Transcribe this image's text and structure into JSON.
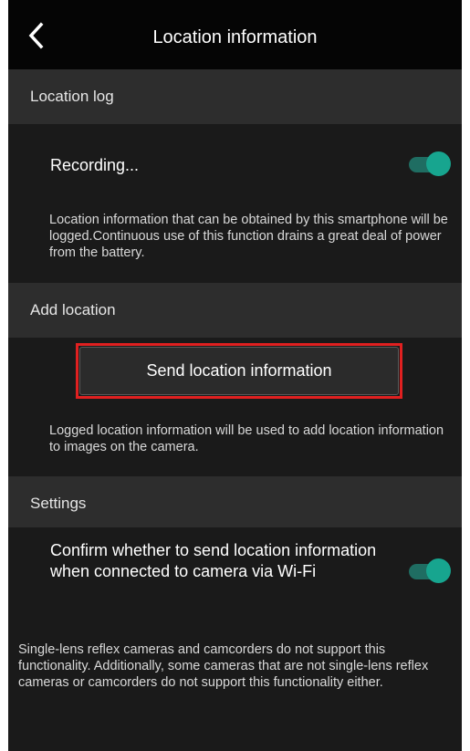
{
  "header": {
    "title": "Location information",
    "back_icon": "chevron-left-icon"
  },
  "location_log": {
    "section_title": "Location log",
    "recording_label": "Recording...",
    "recording_on": true,
    "description": "Location information that can be obtained by this smartphone will be logged.Continuous use of this function drains a great deal of power from the battery."
  },
  "add_location": {
    "section_title": "Add location",
    "send_button_label": "Send location information",
    "description": "Logged location information will be used to add location information to images on the camera."
  },
  "settings": {
    "section_title": "Settings",
    "confirm_label": "Confirm whether to send location information when connected to camera via Wi-Fi",
    "confirm_on": true,
    "footer_note": "Single-lens reflex cameras and camcorders do not support this functionality. Additionally, some cameras that are not single-lens reflex cameras or camcorders do not support this functionality either."
  },
  "colors": {
    "toggle_on_knob": "#17a58f",
    "toggle_on_track": "#1f6d62",
    "highlight": "#e02020",
    "background": "#1a1a1a",
    "section_header": "#2d2d2d"
  }
}
